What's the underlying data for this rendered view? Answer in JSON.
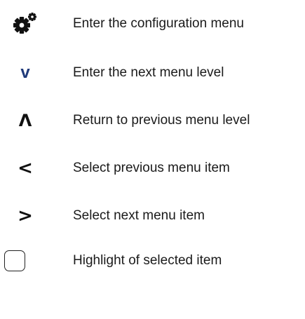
{
  "legend": {
    "items": [
      {
        "icon": "gear-icon",
        "label": "Enter the configuration menu"
      },
      {
        "icon": "chevron-down-icon",
        "glyph": "v",
        "label": "Enter the next menu level"
      },
      {
        "icon": "caret-up-icon",
        "glyph": "Λ",
        "label": "Return to previous menu level"
      },
      {
        "icon": "less-than-icon",
        "glyph": "<",
        "label": "Select previous menu item"
      },
      {
        "icon": "greater-than-icon",
        "glyph": ">",
        "label": "Select next menu item"
      },
      {
        "icon": "rounded-box-icon",
        "label": "Highlight of selected item"
      }
    ]
  },
  "colors": {
    "text": "#1a1a1a",
    "icon_dark": "#111111",
    "icon_blue": "#1f3a7a"
  }
}
